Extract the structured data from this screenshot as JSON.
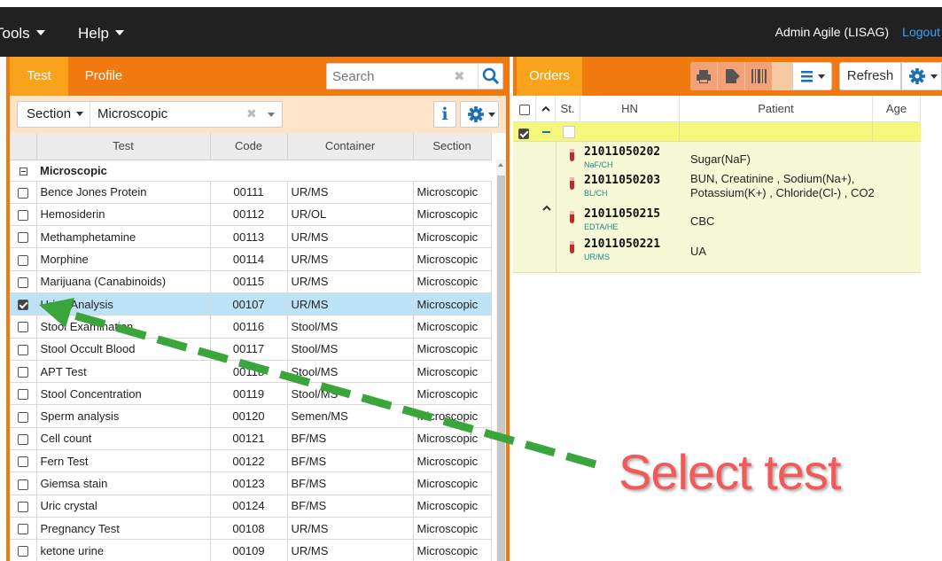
{
  "topbar": {
    "menus": [
      {
        "label": "Tools"
      },
      {
        "label": "Help"
      }
    ],
    "user": "Admin Agile (LISAG)",
    "logout": "Logout"
  },
  "left_panel": {
    "tabs": [
      {
        "label": "Test"
      },
      {
        "label": "Profile"
      }
    ],
    "search": {
      "placeholder": "Search",
      "value": ""
    },
    "filter": {
      "field": "Section",
      "value": "Microscopic"
    },
    "columns": [
      "Test",
      "Code",
      "Container",
      "Section"
    ],
    "group": "Microscopic",
    "rows": [
      {
        "test": "Bence Jones Protein",
        "code": "00111",
        "container": "UR/MS",
        "section": "Microscopic",
        "checked": false
      },
      {
        "test": "Hemosiderin",
        "code": "00112",
        "container": "UR/OL",
        "section": "Microscopic",
        "checked": false
      },
      {
        "test": "Methamphetamine",
        "code": "00113",
        "container": "UR/MS",
        "section": "Microscopic",
        "checked": false
      },
      {
        "test": "Morphine",
        "code": "00114",
        "container": "UR/MS",
        "section": "Microscopic",
        "checked": false
      },
      {
        "test": "Marijuana (Canabinoids)",
        "code": "00115",
        "container": "UR/MS",
        "section": "Microscopic",
        "checked": false
      },
      {
        "test": "Urine Analysis",
        "code": "00107",
        "container": "UR/MS",
        "section": "Microscopic",
        "checked": true
      },
      {
        "test": "Stool Examination",
        "code": "00116",
        "container": "Stool/MS",
        "section": "Microscopic",
        "checked": false
      },
      {
        "test": "Stool Occult Blood",
        "code": "00117",
        "container": "Stool/MS",
        "section": "Microscopic",
        "checked": false
      },
      {
        "test": "APT Test",
        "code": "00118",
        "container": "Stool/MS",
        "section": "Microscopic",
        "checked": false
      },
      {
        "test": "Stool Concentration",
        "code": "00119",
        "container": "Stool/MS",
        "section": "Microscopic",
        "checked": false
      },
      {
        "test": "Sperm analysis",
        "code": "00120",
        "container": "Semen/MS",
        "section": "Microscopic",
        "checked": false
      },
      {
        "test": "Cell count",
        "code": "00121",
        "container": "BF/MS",
        "section": "Microscopic",
        "checked": false
      },
      {
        "test": "Fern Test",
        "code": "00122",
        "container": "BF/MS",
        "section": "Microscopic",
        "checked": false
      },
      {
        "test": "Giemsa stain",
        "code": "00123",
        "container": "BF/MS",
        "section": "Microscopic",
        "checked": false
      },
      {
        "test": "Uric crystal",
        "code": "00124",
        "container": "BF/MS",
        "section": "Microscopic",
        "checked": false
      },
      {
        "test": "Pregnancy Test",
        "code": "00108",
        "container": "UR/MS",
        "section": "Microscopic",
        "checked": false
      },
      {
        "test": "ketone urine",
        "code": "00109",
        "container": "UR/MS",
        "section": "Microscopic",
        "checked": false
      }
    ]
  },
  "right_panel": {
    "tab": "Orders",
    "refresh": "Refresh",
    "columns": {
      "status": "St.",
      "hn": "HN",
      "patient": "Patient",
      "age": "Age"
    },
    "orders": [
      {
        "hn": "21011050202",
        "tube": "NaF/CH",
        "tube_color": "#c62828",
        "tests": "Sugar(NaF)"
      },
      {
        "hn": "21011050203",
        "tube": "BL/CH",
        "tube_color": "#c62828",
        "tests": "BUN, Creatinine , Sodium(Na+), Potassium(K+) , Chloride(Cl-) , CO2"
      },
      {
        "hn": "21011050215",
        "tube": "EDTA/HE",
        "tube_color": "#c62828",
        "tests": "CBC"
      },
      {
        "hn": "21011050221",
        "tube": "UR/MS",
        "tube_color": "#c62828",
        "tests": "UA"
      }
    ]
  },
  "annotation": {
    "label": "Select test",
    "color": "#f25a5a",
    "arrow_color": "#3aa53a"
  },
  "colors": {
    "accent": "#f07a10",
    "tab_active": "#f9a21b",
    "topbar": "#212121",
    "selected_row": "#bde3f7",
    "order_highlight": "#f4f77a"
  }
}
